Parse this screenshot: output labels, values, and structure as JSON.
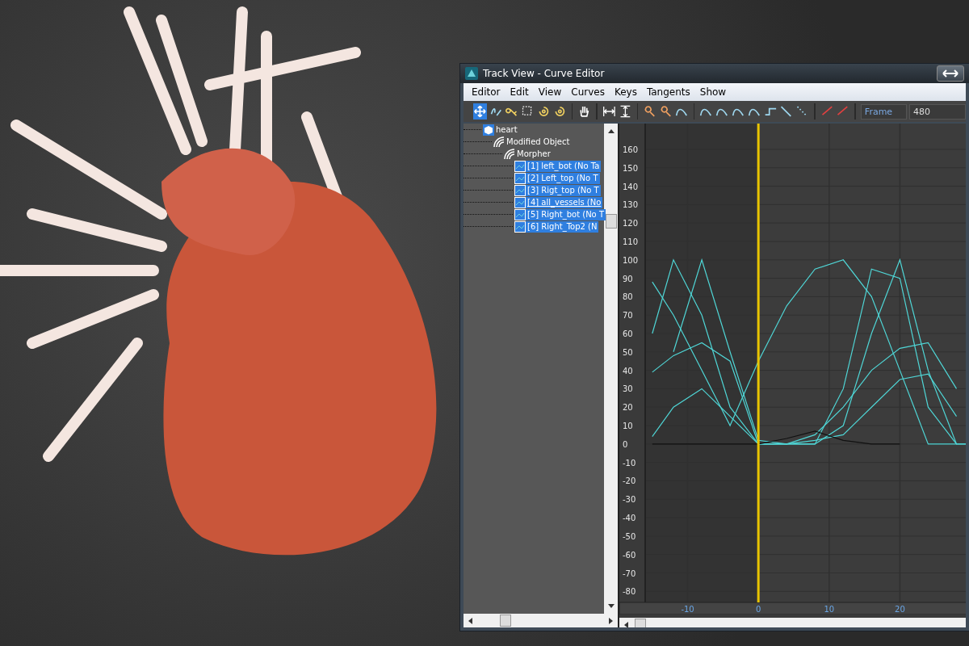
{
  "window": {
    "title": "Track View - Curve Editor"
  },
  "menu": [
    "Editor",
    "Edit",
    "View",
    "Curves",
    "Keys",
    "Tangents",
    "Show"
  ],
  "toolbar": {
    "frame_label": "Frame",
    "frame_value": "480"
  },
  "tree": [
    {
      "label": "heart",
      "kind": "object",
      "selected": false,
      "underlined": false,
      "children": [
        {
          "label": "Modified Object",
          "kind": "modifier",
          "selected": false,
          "underlined": false,
          "children": [
            {
              "label": "Morpher",
              "kind": "modifier",
              "selected": false,
              "underlined": false,
              "children": [
                {
                  "label": "[1] left_bot  (No Ta",
                  "kind": "channel",
                  "selected": true,
                  "underlined": false
                },
                {
                  "label": "[2] Left_top  (No T",
                  "kind": "channel",
                  "selected": true,
                  "underlined": false
                },
                {
                  "label": "[3] Rigt_top  (No T",
                  "kind": "channel",
                  "selected": true,
                  "underlined": false
                },
                {
                  "label": "[4] all_vessels  (No",
                  "kind": "channel",
                  "selected": true,
                  "underlined": true
                },
                {
                  "label": "[5] Right_bot  (No T",
                  "kind": "channel",
                  "selected": true,
                  "underlined": false
                },
                {
                  "label": "[6] Right_Top2  (N",
                  "kind": "channel",
                  "selected": true,
                  "underlined": false
                }
              ]
            }
          ]
        }
      ]
    }
  ],
  "curve_editor": {
    "chart_data": {
      "type": "line",
      "grid": true,
      "xlim": [
        -16,
        30
      ],
      "ref_lines": [
        {
          "axis": "x",
          "value": 0
        }
      ],
      "ylim": [
        -86,
        174
      ],
      "x": [
        -15,
        -12,
        -8,
        -4,
        0,
        4,
        8,
        12,
        16,
        20,
        24,
        28,
        30
      ],
      "xticks": [
        -10,
        0,
        10,
        20
      ],
      "yticks": [
        -80,
        -70,
        -60,
        -50,
        -40,
        -30,
        -20,
        -10,
        0,
        10,
        20,
        30,
        40,
        50,
        60,
        70,
        80,
        90,
        100,
        110,
        120,
        130,
        140,
        150,
        160
      ],
      "series": [
        {
          "color": "#4fd6d6",
          "values": [
            88,
            70,
            40,
            10,
            45,
            75,
            95,
            100,
            80,
            40,
            0,
            0,
            null
          ]
        },
        {
          "color": "#4fd6d6",
          "values": [
            null,
            50,
            100,
            50,
            2,
            0,
            0,
            30,
            95,
            90,
            20,
            0,
            0
          ]
        },
        {
          "color": "#4fd6d6",
          "values": [
            60,
            100,
            70,
            20,
            0,
            0,
            0,
            10,
            60,
            100,
            40,
            0,
            0
          ]
        },
        {
          "color": "#4fd6d6",
          "values": [
            39,
            48,
            55,
            45,
            0,
            0,
            5,
            20,
            40,
            52,
            55,
            30,
            null
          ]
        },
        {
          "color": "#4fd6d6",
          "values": [
            4,
            20,
            30,
            15,
            0,
            0,
            2,
            5,
            20,
            35,
            38,
            15,
            null
          ]
        },
        {
          "color": "#111111",
          "values": [
            0,
            0,
            0,
            0,
            0,
            3,
            7,
            2,
            0,
            0,
            null,
            null,
            null
          ]
        }
      ]
    }
  }
}
